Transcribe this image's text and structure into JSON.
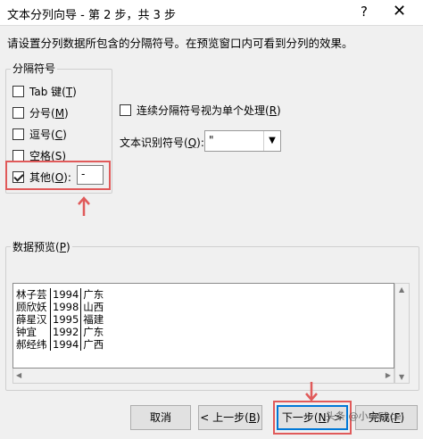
{
  "window": {
    "title": "文本分列向导 - 第 2 步，共 3 步",
    "help_label": "?",
    "close_label": "✕"
  },
  "instruction": "请设置分列数据所包含的分隔符号。在预览窗口内可看到分列的效果。",
  "delimiters": {
    "legend": "分隔符号",
    "tab": {
      "label": "Tab 键(",
      "key": "T",
      "suffix": ")",
      "checked": false
    },
    "semicolon": {
      "label": "分号(",
      "key": "M",
      "suffix": ")",
      "checked": false
    },
    "comma": {
      "label": "逗号(",
      "key": "C",
      "suffix": ")",
      "checked": false
    },
    "space": {
      "label": "空格(",
      "key": "S",
      "suffix": ")",
      "checked": false
    },
    "other": {
      "label": "其他(",
      "key": "O",
      "suffix": "):",
      "checked": true,
      "value": "-"
    }
  },
  "consecutive": {
    "label": "连续分隔符号视为单个处理(",
    "key": "R",
    "suffix": ")",
    "checked": false
  },
  "qualifier": {
    "label": "文本识别符号(",
    "key": "Q",
    "suffix": "):",
    "value": "\"",
    "dropdown_icon": "chevron-down-icon"
  },
  "preview": {
    "legend": "数据预览(",
    "key": "P",
    "suffix": ")",
    "rows": [
      [
        "林子芸",
        "1994",
        "广东"
      ],
      [
        "顾欣妖",
        "1998",
        "山西"
      ],
      [
        "薛星汉",
        "1995",
        "福建"
      ],
      [
        "钟宜",
        "1992",
        "广东"
      ],
      [
        "郝经纬",
        "1994",
        "广西"
      ]
    ]
  },
  "buttons": {
    "cancel": "取消",
    "back": {
      "label": "< 上一步(",
      "key": "B",
      "suffix": ")"
    },
    "next": {
      "label": "下一步(",
      "key": "N",
      "suffix": ") >"
    },
    "finish": {
      "label": "完成(",
      "key": "F",
      "suffix": ")"
    }
  },
  "watermark": "头条 @小小Excel",
  "colors": {
    "highlight": "#e05a5a",
    "primary_border": "#0078d7"
  }
}
